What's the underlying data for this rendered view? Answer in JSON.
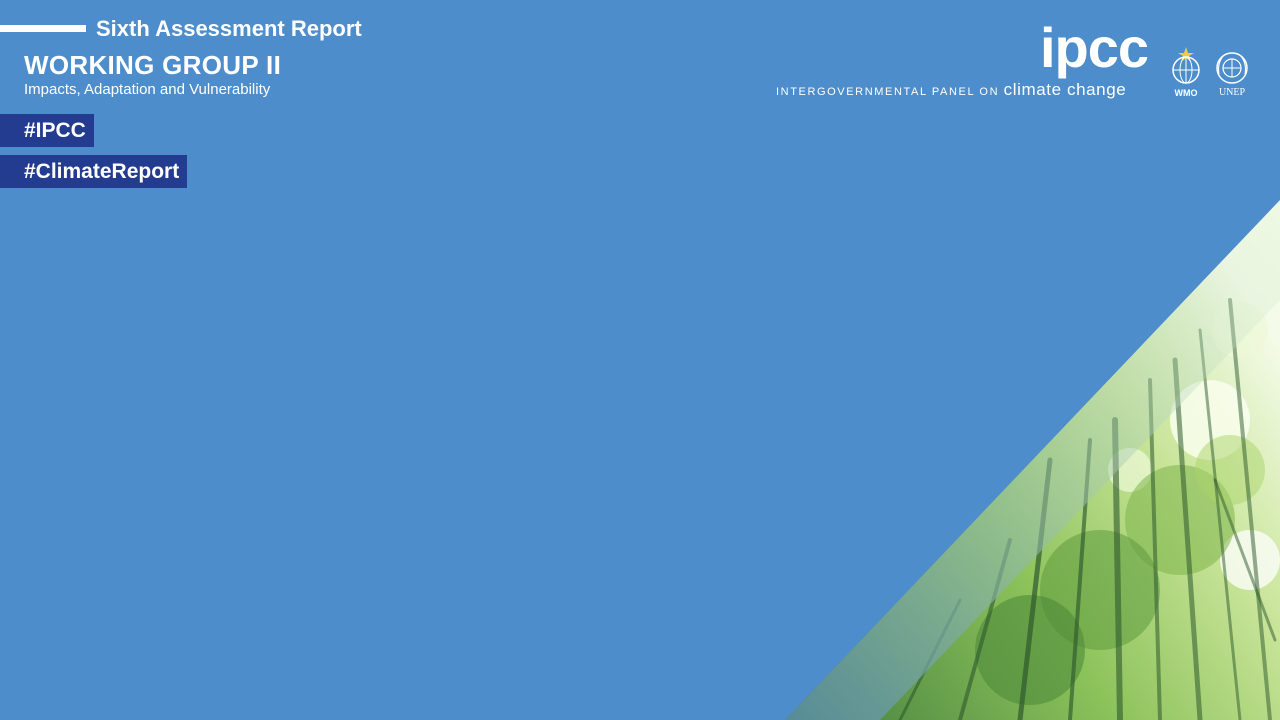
{
  "header": {
    "report_title": "Sixth Assessment Report",
    "working_group": "WORKING GROUP II",
    "subtitle": "Impacts, Adaptation and Vulnerability"
  },
  "hashtags": [
    "#IPCC",
    "#ClimateReport"
  ],
  "logos": {
    "ipcc_mark": "ipcc",
    "ipcc_full_small": "INTERGOVERNMENTAL PANEL ON",
    "ipcc_full_big": "climate change",
    "wmo_label": "WMO",
    "unep_label": "UNEP"
  },
  "decoration": {
    "image": "bamboo-forest-canopy-photo",
    "background_color": "#4d8dcb",
    "hashtag_color": "#233c8f"
  }
}
